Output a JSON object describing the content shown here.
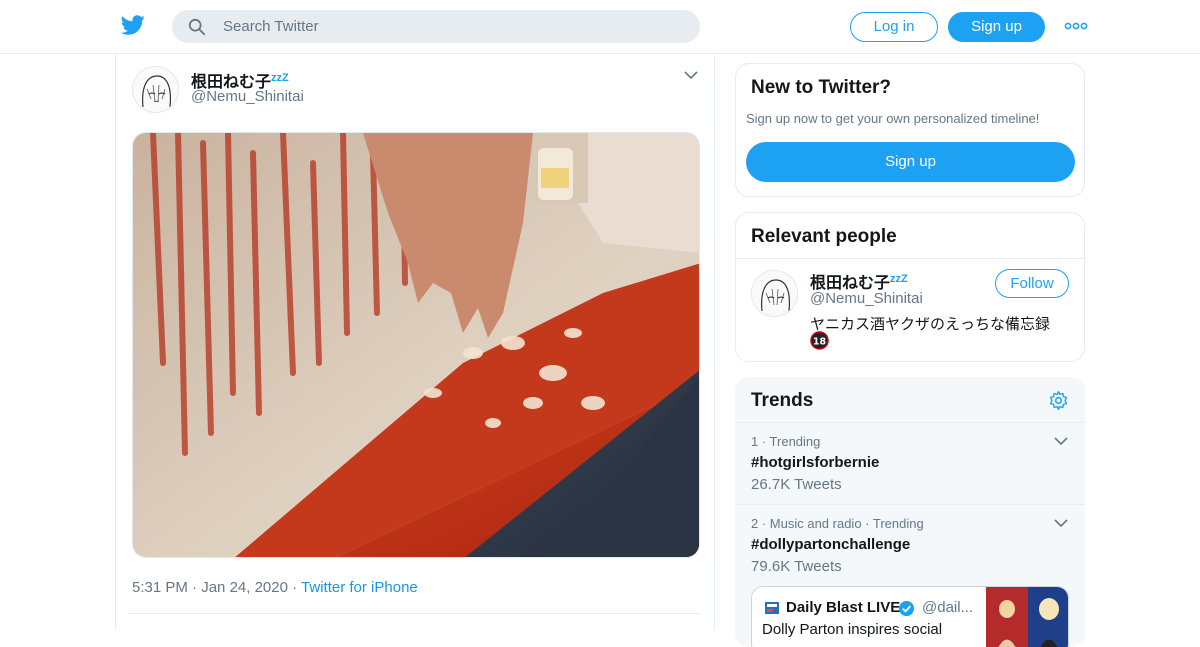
{
  "header": {
    "search_placeholder": "Search Twitter",
    "login_label": "Log in",
    "signup_label": "Sign up",
    "brand_color": "#1da1f2"
  },
  "tweet": {
    "display_name": "根田ねむ子",
    "name_suffix": "zzZ",
    "handle": "@Nemu_Shinitai",
    "time": "5:31 PM",
    "date": "Jan 24, 2020",
    "source": "Twitter for iPhone",
    "sep": "·"
  },
  "sidebar": {
    "new_title": "New to Twitter?",
    "new_subtitle": "Sign up now to get your own personalized timeline!",
    "new_signup": "Sign up",
    "relevant_title": "Relevant people",
    "person": {
      "display_name": "根田ねむ子",
      "name_suffix": "zzZ",
      "handle": "@Nemu_Shinitai",
      "follow_label": "Follow",
      "bio": "ヤニカス酒ヤクザのえっちな備忘録"
    },
    "trends_title": "Trends",
    "trends": [
      {
        "meta": "1 · Trending",
        "tag": "#hotgirlsforbernie",
        "count": "26.7K Tweets"
      },
      {
        "meta": "2 · Music and radio · Trending",
        "tag": "#dollypartonchallenge",
        "count": "79.6K Tweets"
      }
    ],
    "news": {
      "title": "Daily Blast LIVE",
      "handle": "@dail...",
      "body": "Dolly Parton inspires social"
    }
  }
}
